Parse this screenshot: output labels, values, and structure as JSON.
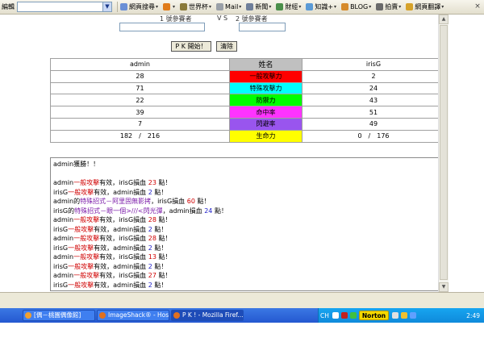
{
  "toolbar": {
    "edit_label": "編輯",
    "items": [
      {
        "label": "網頁搜尋",
        "icon": "search-icon",
        "color": "#6a8fd6"
      },
      {
        "label": "",
        "icon": "plus-icon",
        "color": "#e07b1a"
      },
      {
        "label": "世界杯",
        "icon": "soccer-icon",
        "color": "#8a7a3a"
      },
      {
        "label": "Mail",
        "icon": "mail-icon",
        "color": "#9aa0a8"
      },
      {
        "label": "新聞",
        "icon": "news-icon",
        "color": "#6f7f9a"
      },
      {
        "label": "財經",
        "icon": "finance-icon",
        "color": "#4a8f4a"
      },
      {
        "label": "知識+",
        "icon": "knowledge-icon",
        "color": "#5a9ad6"
      },
      {
        "label": "BLOG",
        "icon": "blog-icon",
        "color": "#d68a2a"
      },
      {
        "label": "拍賣",
        "icon": "auction-icon",
        "color": "#6a6a6a"
      },
      {
        "label": "網頁翻譯",
        "icon": "translate-icon",
        "color": "#d6a22a"
      }
    ]
  },
  "vs_header": {
    "left": "1 號參賽者",
    "vs": "V S",
    "right": "2 號參賽者"
  },
  "buttons": {
    "pk_start": "P K 開始！",
    "clear": "清除"
  },
  "stats": {
    "left_name": "admin",
    "header": "姓名",
    "right_name": "irisG",
    "rows": [
      {
        "left": "28",
        "label": "一般攻擊力",
        "right": "2",
        "color": "#ff0000"
      },
      {
        "left": "71",
        "label": "特殊攻擊力",
        "right": "24",
        "color": "#00ffff"
      },
      {
        "left": "22",
        "label": "防禦力",
        "right": "43",
        "color": "#00ff00"
      },
      {
        "left": "39",
        "label": "命中率",
        "right": "51",
        "color": "#ff33ff"
      },
      {
        "left": "7",
        "label": "閃避率",
        "right": "49",
        "color": "#9955ee"
      },
      {
        "left": "182　/　216",
        "label": "生命力",
        "right": "0　/　176",
        "color": "#ffff00"
      }
    ],
    "header_color": "#c0c0c0"
  },
  "log": {
    "winner": "admin獲勝！！",
    "lines": [
      [
        {
          "t": "admin"
        },
        {
          "t": "一般攻擊",
          "c": "red"
        },
        {
          "t": "有效，irisG損血 "
        },
        {
          "t": "23",
          "c": "red"
        },
        {
          "t": " 點！"
        }
      ],
      [
        {
          "t": "irisG"
        },
        {
          "t": "一般攻擊",
          "c": "red"
        },
        {
          "t": "有效，admin損血 "
        },
        {
          "t": "2",
          "c": "blue"
        },
        {
          "t": " 點！"
        }
      ],
      [
        {
          "t": "admin的"
        },
        {
          "t": "特殊招式－阿里固無影拷",
          "c": "purple"
        },
        {
          "t": "，irisG損血 "
        },
        {
          "t": "60",
          "c": "red"
        },
        {
          "t": " 點！"
        }
      ],
      [
        {
          "t": "irisG的"
        },
        {
          "t": "特殊招式－眼一個>///<閃光彈",
          "c": "purple"
        },
        {
          "t": "，admin損血 "
        },
        {
          "t": "24",
          "c": "blue"
        },
        {
          "t": " 點！"
        }
      ],
      [
        {
          "t": "admin"
        },
        {
          "t": "一般攻擊",
          "c": "red"
        },
        {
          "t": "有效，irisG損血 "
        },
        {
          "t": "28",
          "c": "red"
        },
        {
          "t": " 點！"
        }
      ],
      [
        {
          "t": "irisG"
        },
        {
          "t": "一般攻擊",
          "c": "red"
        },
        {
          "t": "有效，admin損血 "
        },
        {
          "t": "2",
          "c": "blue"
        },
        {
          "t": " 點！"
        }
      ],
      [
        {
          "t": "admin"
        },
        {
          "t": "一般攻擊",
          "c": "red"
        },
        {
          "t": "有效，irisG損血 "
        },
        {
          "t": "28",
          "c": "red"
        },
        {
          "t": " 點！"
        }
      ],
      [
        {
          "t": "irisG"
        },
        {
          "t": "一般攻擊",
          "c": "red"
        },
        {
          "t": "有效，admin損血 "
        },
        {
          "t": "2",
          "c": "blue"
        },
        {
          "t": " 點！"
        }
      ],
      [
        {
          "t": "admin"
        },
        {
          "t": "一般攻擊",
          "c": "red"
        },
        {
          "t": "有效，irisG損血 "
        },
        {
          "t": "13",
          "c": "red"
        },
        {
          "t": " 點！"
        }
      ],
      [
        {
          "t": "irisG"
        },
        {
          "t": "一般攻擊",
          "c": "red"
        },
        {
          "t": "有效，admin損血 "
        },
        {
          "t": "2",
          "c": "blue"
        },
        {
          "t": " 點！"
        }
      ],
      [
        {
          "t": "admin"
        },
        {
          "t": "一般攻擊",
          "c": "red"
        },
        {
          "t": "有效，irisG損血 "
        },
        {
          "t": "27",
          "c": "red"
        },
        {
          "t": " 點！"
        }
      ],
      [
        {
          "t": "irisG"
        },
        {
          "t": "一般攻擊",
          "c": "red"
        },
        {
          "t": "有效，admin損血 "
        },
        {
          "t": "2",
          "c": "blue"
        },
        {
          "t": " 點！"
        }
      ]
    ]
  },
  "taskbar": {
    "tasks": [
      {
        "label": "[偶－桃園偶像館]",
        "color": "#f0a030"
      },
      {
        "label": "ImageShack® - Hostin...",
        "color": "#e07020"
      },
      {
        "label": "P K ! - Mozilla Firef...",
        "color": "#e07020"
      }
    ],
    "language": "CH",
    "norton": "Norton",
    "clock": "2:49"
  }
}
